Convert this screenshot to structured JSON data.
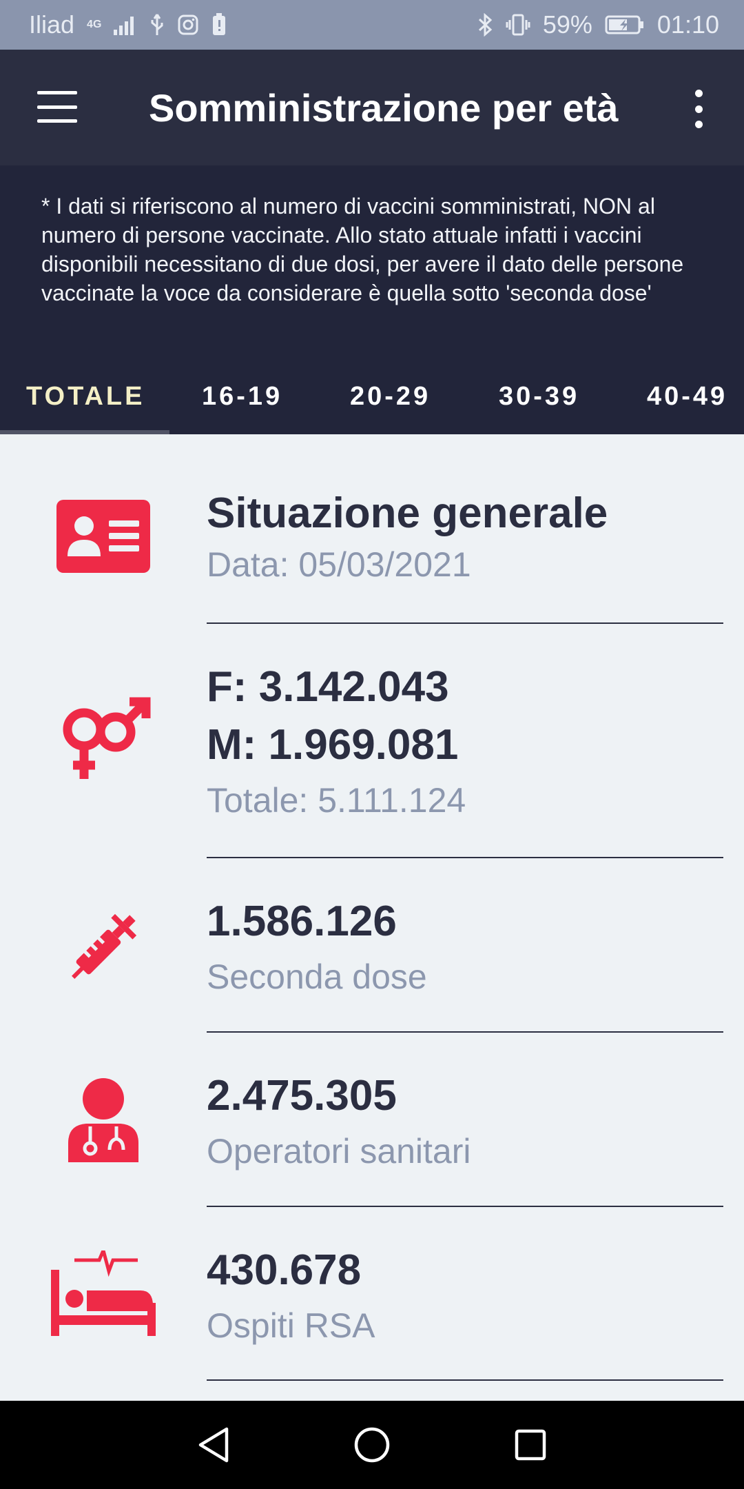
{
  "status_bar": {
    "carrier": "Iliad",
    "network": "4G",
    "battery": "59%",
    "time": "01:10"
  },
  "toolbar": {
    "title": "Somministrazione per età"
  },
  "note": {
    "text": "* I dati si riferiscono al numero di vaccini somministrati, NON al numero di persone vaccinate. Allo stato attuale infatti i vaccini disponibili necessitano di due dosi, per avere il dato delle persone vaccinate la voce da considerare è quella sotto 'seconda dose'"
  },
  "tabs": [
    {
      "label": "TOTALE",
      "active": true
    },
    {
      "label": "16-19",
      "active": false
    },
    {
      "label": "20-29",
      "active": false
    },
    {
      "label": "30-39",
      "active": false
    },
    {
      "label": "40-49",
      "active": false
    }
  ],
  "rows": {
    "general": {
      "title": "Situazione generale",
      "subtitle": "Data: 05/03/2021",
      "icon": "id-card-icon"
    },
    "gender": {
      "female": "F: 3.142.043",
      "male": "M: 1.969.081",
      "total": "Totale: 5.111.124",
      "icon": "gender-icon"
    },
    "second_dose": {
      "value": "1.586.126",
      "label": "Seconda dose",
      "icon": "syringe-icon"
    },
    "health_workers": {
      "value": "2.475.305",
      "label": "Operatori sanitari",
      "icon": "doctor-icon"
    },
    "rsa_guests": {
      "value": "430.678",
      "label": "Ospiti RSA",
      "icon": "hospital-bed-icon"
    }
  },
  "colors": {
    "accent": "#ee2a47",
    "toolbar": "#2b2e41",
    "note_bg": "#22253a",
    "text_primary": "#2b2e41",
    "text_secondary": "#8c97ae"
  }
}
